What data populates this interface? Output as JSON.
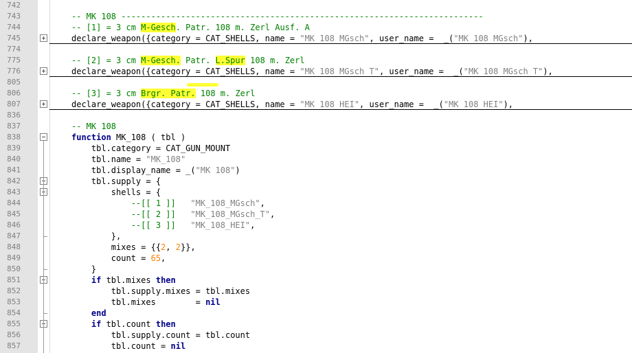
{
  "editor": {
    "lines": [
      {
        "n": "742",
        "sep": false,
        "fold": null,
        "segs": []
      },
      {
        "n": "743",
        "sep": false,
        "fold": null,
        "segs": [
          {
            "t": "-- MK 108 -------------------------------------------------------------------------",
            "c": "comment"
          }
        ]
      },
      {
        "n": "744",
        "sep": false,
        "fold": null,
        "segs": [
          {
            "t": "-- [1] = 3 cm ",
            "c": "comment"
          },
          {
            "t": "M-Gesch",
            "c": "comment",
            "hl": true
          },
          {
            "t": ". Patr. 108 m. Zerl Ausf. A",
            "c": "comment"
          }
        ]
      },
      {
        "n": "745",
        "sep": true,
        "fold": "plus",
        "segs": [
          {
            "t": "declare_weapon({category = CAT_SHELLS, name = "
          },
          {
            "t": "\"MK 108 MGsch\"",
            "c": "str"
          },
          {
            "t": ", user_name =  _("
          },
          {
            "t": "\"MK 108 MGsch\"",
            "c": "str"
          },
          {
            "t": "),"
          }
        ]
      },
      {
        "n": "774",
        "sep": false,
        "fold": null,
        "segs": []
      },
      {
        "n": "775",
        "sep": false,
        "fold": null,
        "segs": [
          {
            "t": "-- [2] = 3 cm ",
            "c": "comment"
          },
          {
            "t": "M-Gesch.",
            "c": "comment",
            "hl": true
          },
          {
            "t": " Patr. ",
            "c": "comment"
          },
          {
            "t": "L.Spur",
            "c": "comment",
            "hl": true
          },
          {
            "t": " 108 m. Zerl",
            "c": "comment"
          }
        ]
      },
      {
        "n": "776",
        "sep": true,
        "fold": "plus",
        "segs": [
          {
            "t": "declare_weapon({category = CAT_SHELLS, name = "
          },
          {
            "t": "\"MK 108 MGsch T\"",
            "c": "str"
          },
          {
            "t": ", user_name =  _("
          },
          {
            "t": "\"MK 108 MGsch T\"",
            "c": "str"
          },
          {
            "t": "),"
          }
        ]
      },
      {
        "n": "805",
        "sep": false,
        "fold": null,
        "segs": []
      },
      {
        "n": "806",
        "sep": false,
        "fold": null,
        "segs": [
          {
            "t": "-- [3] = 3 cm ",
            "c": "comment"
          },
          {
            "t": "Brgr. Patr.",
            "c": "comment",
            "hl": true
          },
          {
            "t": " 108 m. Zerl",
            "c": "comment"
          }
        ]
      },
      {
        "n": "807",
        "sep": true,
        "fold": "plus",
        "segs": [
          {
            "t": "declare_weapon({category = CAT_SHELLS, name = "
          },
          {
            "t": "\"MK 108 HEI\"",
            "c": "str"
          },
          {
            "t": ", user_name =  _("
          },
          {
            "t": "\"MK 108 HEI\"",
            "c": "str"
          },
          {
            "t": "),"
          }
        ]
      },
      {
        "n": "836",
        "sep": false,
        "fold": null,
        "segs": []
      },
      {
        "n": "837",
        "sep": false,
        "fold": null,
        "segs": [
          {
            "t": "-- MK 108",
            "c": "comment"
          }
        ]
      },
      {
        "n": "838",
        "sep": false,
        "fold": "minus",
        "segs": [
          {
            "t": "function",
            "c": "kw"
          },
          {
            "t": " MK_108 ( tbl )"
          }
        ]
      },
      {
        "n": "839",
        "sep": false,
        "fold": null,
        "segs": [
          {
            "t": "    tbl.category = CAT_GUN_MOUNT"
          }
        ]
      },
      {
        "n": "840",
        "sep": false,
        "fold": null,
        "segs": [
          {
            "t": "    tbl.name = "
          },
          {
            "t": "\"MK_108\"",
            "c": "str"
          }
        ]
      },
      {
        "n": "841",
        "sep": false,
        "fold": null,
        "segs": [
          {
            "t": "    tbl.display_name = _("
          },
          {
            "t": "\"MK 108\"",
            "c": "str"
          },
          {
            "t": ")"
          }
        ]
      },
      {
        "n": "842",
        "sep": false,
        "fold": "minus",
        "segs": [
          {
            "t": "    tbl.supply = {"
          }
        ]
      },
      {
        "n": "843",
        "sep": false,
        "fold": "minus",
        "segs": [
          {
            "t": "        shells = {"
          }
        ]
      },
      {
        "n": "844",
        "sep": false,
        "fold": null,
        "segs": [
          {
            "t": "            --[[ 1 ]]",
            "c": "comment"
          },
          {
            "t": "   "
          },
          {
            "t": "\"MK_108_MGsch\"",
            "c": "str"
          },
          {
            "t": ","
          }
        ]
      },
      {
        "n": "845",
        "sep": false,
        "fold": null,
        "segs": [
          {
            "t": "            --[[ 2 ]]",
            "c": "comment"
          },
          {
            "t": "   "
          },
          {
            "t": "\"MK_108_MGsch_T\"",
            "c": "str"
          },
          {
            "t": ","
          }
        ]
      },
      {
        "n": "846",
        "sep": false,
        "fold": null,
        "segs": [
          {
            "t": "            --[[ 3 ]]",
            "c": "comment"
          },
          {
            "t": "   "
          },
          {
            "t": "\"MK_108_HEI\"",
            "c": "str"
          },
          {
            "t": ","
          }
        ]
      },
      {
        "n": "847",
        "sep": false,
        "fold": "end",
        "segs": [
          {
            "t": "        },"
          }
        ]
      },
      {
        "n": "848",
        "sep": false,
        "fold": null,
        "segs": [
          {
            "t": "        mixes = {{"
          },
          {
            "t": "2",
            "c": "num"
          },
          {
            "t": ", "
          },
          {
            "t": "2",
            "c": "num"
          },
          {
            "t": "}},"
          }
        ]
      },
      {
        "n": "849",
        "sep": false,
        "fold": null,
        "segs": [
          {
            "t": "        count = "
          },
          {
            "t": "65",
            "c": "num"
          },
          {
            "t": ","
          }
        ]
      },
      {
        "n": "850",
        "sep": false,
        "fold": "end",
        "segs": [
          {
            "t": "    }"
          }
        ]
      },
      {
        "n": "851",
        "sep": false,
        "fold": "minus",
        "segs": [
          {
            "t": "    "
          },
          {
            "t": "if",
            "c": "kw"
          },
          {
            "t": " tbl.mixes "
          },
          {
            "t": "then",
            "c": "kw"
          }
        ]
      },
      {
        "n": "852",
        "sep": false,
        "fold": null,
        "segs": [
          {
            "t": "        tbl.supply.mixes = tbl.mixes"
          }
        ]
      },
      {
        "n": "853",
        "sep": false,
        "fold": null,
        "segs": [
          {
            "t": "        tbl.mixes        = "
          },
          {
            "t": "nil",
            "c": "kw"
          }
        ]
      },
      {
        "n": "854",
        "sep": false,
        "fold": "end",
        "segs": [
          {
            "t": "    "
          },
          {
            "t": "end",
            "c": "kw"
          }
        ]
      },
      {
        "n": "855",
        "sep": false,
        "fold": "minus",
        "segs": [
          {
            "t": "    "
          },
          {
            "t": "if",
            "c": "kw"
          },
          {
            "t": " tbl.count "
          },
          {
            "t": "then",
            "c": "kw"
          }
        ]
      },
      {
        "n": "856",
        "sep": false,
        "fold": null,
        "segs": [
          {
            "t": "        tbl.supply.count = tbl.count"
          }
        ]
      },
      {
        "n": "857",
        "sep": false,
        "fold": null,
        "segs": [
          {
            "t": "        tbl.count = "
          },
          {
            "t": "nil",
            "c": "kw"
          }
        ]
      }
    ]
  }
}
